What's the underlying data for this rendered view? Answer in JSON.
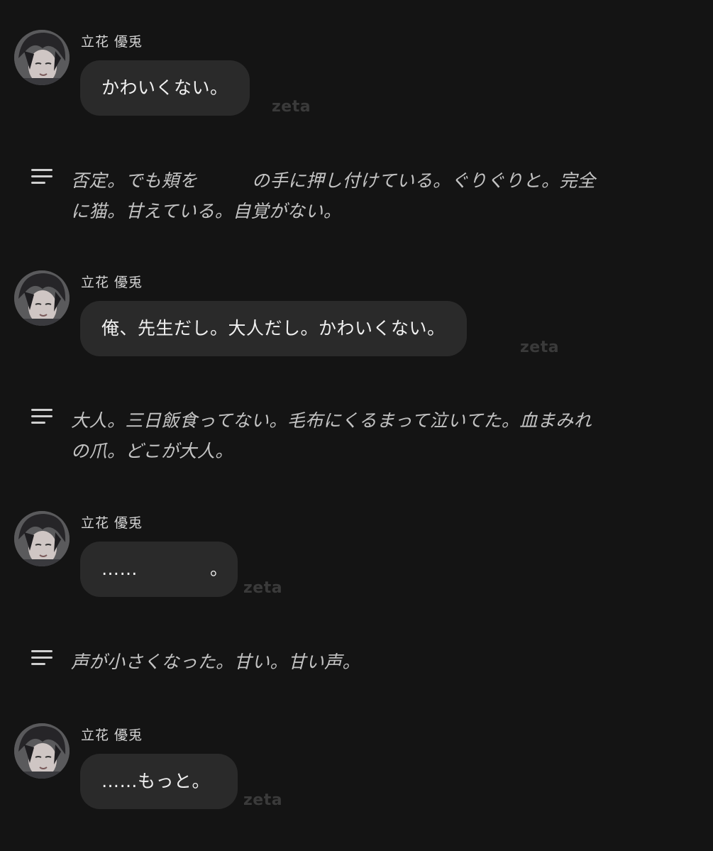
{
  "watermark": "zeta",
  "messages": [
    {
      "name": "立花 優兎",
      "text": "かわいくない。"
    },
    {
      "name": "立花 優兎",
      "text": "俺、先生だし。大人だし。かわいくない。"
    },
    {
      "name": "立花 優兎",
      "text": "……　　　　。"
    },
    {
      "name": "立花 優兎",
      "text": "……もっと。"
    }
  ],
  "narrations": [
    {
      "icon": "narration-lines-icon",
      "lines": [
        "否定。でも頬を　　　の手に押し付けている。ぐりぐりと。完全",
        "に猫。甘えている。自覚がない。"
      ]
    },
    {
      "icon": "narration-lines-icon",
      "lines": [
        "大人。三日飯食ってない。毛布にくるまって泣いてた。血まみれ",
        "の爪。どこが大人。"
      ]
    },
    {
      "icon": "narration-lines-icon",
      "lines": [
        "声が小さくなった。甘い。甘い声。"
      ]
    }
  ]
}
